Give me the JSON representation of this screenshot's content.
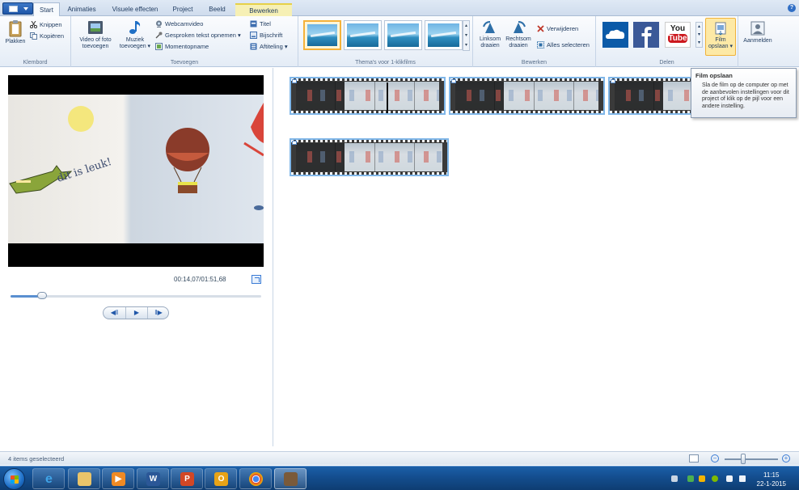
{
  "tabs": [
    {
      "label": "Start",
      "active": true
    },
    {
      "label": "Animaties"
    },
    {
      "label": "Visuele effecten"
    },
    {
      "label": "Project"
    },
    {
      "label": "Beeld"
    },
    {
      "label": "Bewerken",
      "contextual": true
    }
  ],
  "ribbon": {
    "klembord": {
      "label": "Klembord",
      "paste": "Plakken",
      "cut": "Knippen",
      "copy": "Kopiëren"
    },
    "toevoegen": {
      "label": "Toevoegen",
      "add_video_photo": [
        "Video of foto",
        "toevoegen"
      ],
      "add_music": [
        "Muziek",
        "toevoegen"
      ],
      "webcam": "Webcamvideo",
      "narration": "Gesproken tekst opnemen",
      "snapshot": "Momentopname",
      "title": "Titel",
      "caption": "Bijschrift",
      "credits": "Aftiteling"
    },
    "themes": {
      "label": "Thema's voor 1-klikfilms",
      "count": 4
    },
    "bewerken": {
      "label": "Bewerken",
      "rotate_left": [
        "Linksom",
        "draaien"
      ],
      "rotate_right": [
        "Rechtsom",
        "draaien"
      ],
      "remove": "Verwijderen",
      "select_all": "Alles selecteren"
    },
    "delen": {
      "label": "Delen",
      "youtube_top": "You",
      "youtube_bottom": "Tube",
      "save_movie": [
        "Film",
        "opslaan"
      ]
    },
    "sign_in": "Aanmelden"
  },
  "preview": {
    "time": "00:14,07/01:51,68",
    "progress": 0.126,
    "drawing_text": "dit is leuk!"
  },
  "tooltip": {
    "title": "Film opslaan",
    "body": "Sla de film op de computer op met de aanbevolen instellingen voor dit project of klik op de pijl voor een andere instelling."
  },
  "status": {
    "text": "4 items geselecteerd",
    "zoom": 0.35
  },
  "clock": {
    "time": "11:15",
    "date": "22-1-2015"
  },
  "colors": {
    "accent": "#2f6ec5",
    "selection": "#7fb6e8",
    "taskbar": "#134c8c",
    "tooltip_border": "#8a9bb1"
  }
}
